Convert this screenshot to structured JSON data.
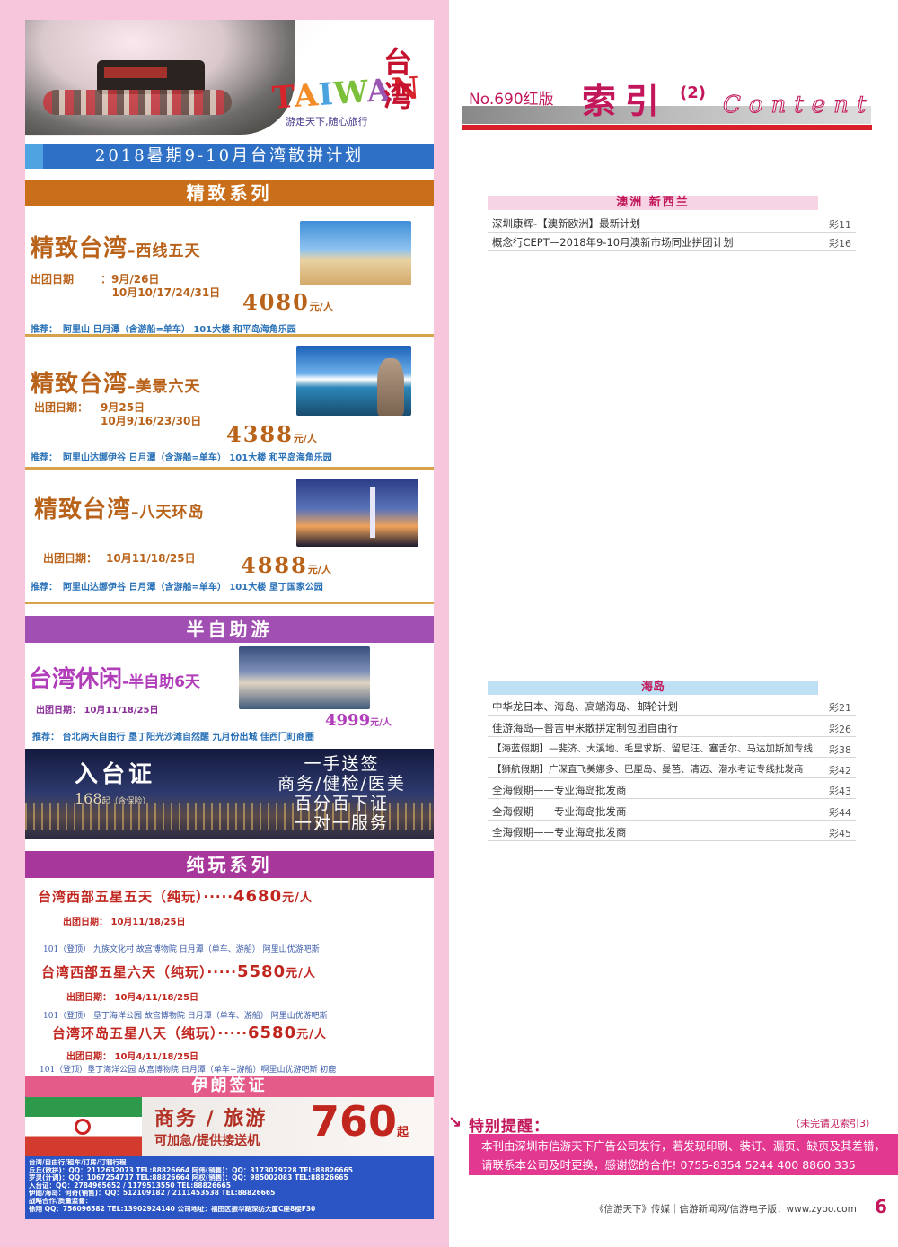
{
  "ad": {
    "logo_text": "TAIWAN",
    "logo_cn": "台湾",
    "logo_slogan": "游走天下,随心旅行",
    "plan_title": "2018暑期9-10月台湾散拼计划",
    "series_jingzhi": "精致系列",
    "tours": [
      {
        "title": "精致台湾",
        "subtitle": "–西线五天",
        "date_label": "出团日期",
        "dates": "：9月/26日\n   10月10/17/24/31日",
        "price": "4080",
        "unit": "元/人",
        "rec_label": "推荐：",
        "rec": "阿里山    日月潭（含游船=单车）     101大楼     和平岛海角乐园"
      },
      {
        "title": "精致台湾",
        "subtitle": "–美景六天",
        "date_label": "出团日期：",
        "dates": "9月25日\n10月9/16/23/30日",
        "price": "4388",
        "unit": "元/人",
        "rec_label": "推荐：",
        "rec": "阿里山达娜伊谷  日月潭（含游船=单车）   101大楼   和平岛海角乐园"
      },
      {
        "title": "精致台湾",
        "subtitle": "–八天环岛",
        "date_label": "出团日期：",
        "dates": "10月11/18/25日",
        "price": "4888",
        "unit": "元/人",
        "rec_label": "推荐：",
        "rec": "阿里山达娜伊谷  日月潭（含游船=单车）  101大楼   垦丁国家公园"
      }
    ],
    "series_semi": "半自助游",
    "leisure": {
      "title": "台湾休闲",
      "subtitle": "-半自助6天",
      "dates": "出团日期：  10月11/18/25日",
      "price": "4999",
      "unit": "元/人",
      "rec_label": "推荐：",
      "rec": "台北两天自由行   垦丁阳光沙滩自然醒    九月份出城    佳西门町商圈"
    },
    "permit": {
      "title": "入台证",
      "price": "168",
      "price_note": "起（含保险）",
      "lines": [
        "一手送签",
        "商务/健检/医美",
        "百分百下证",
        "一对一服务"
      ]
    },
    "series_pure": "纯玩系列",
    "pure": [
      {
        "title": "台湾西部五星五天（纯玩）·····",
        "price": "4680",
        "unit": "元/人",
        "date": "出团日期：  10月11/18/25日",
        "route": "101（登顶）   九族文化村   故宫博物院  日月潭（单车、游船）   阿里山优游吧斯"
      },
      {
        "title": "台湾西部五星六天（纯玩）·····",
        "price": "5580",
        "unit": "元/人",
        "date": "出团日期：  10月4/11/18/25日",
        "route": "101（登顶）   垦丁海洋公园  故宫博物院  日月潭（单车、游船）    阿里山优游吧斯"
      },
      {
        "title": "台湾环岛五星八天（纯玩）·····",
        "price": "6580",
        "unit": "元/人",
        "date": "出团日期：  10月4/11/18/25日",
        "route": "101（登顶）垦丁海洋公园 故宫博物院 日月潭（单车+游船）啊里山优游吧斯   初鹿"
      }
    ],
    "iran": {
      "bar": "伊朗签证",
      "line1": "商务 / 旅游",
      "line2": "可加急/提供接送机",
      "price": "760",
      "price_suffix": "起"
    },
    "contacts": [
      "台湾/自由行/租车/订房/订制行程",
      "丘丘(散拼)：QQ：2112632073  TEL:88826664          阿伟(销售)：QQ：3173079728   TEL:88826665",
      "罗灵(计调)：QQ：1067254717  TEL:88826664          阿权(销售)：QQ：985002083    TEL:88826665",
      "入台证：QQ：2784965652 / 1179513550  TEL:88826665",
      "伊朗/海岛：何奇(销售)：QQ：512109182 / 2111453538  TEL:88826665",
      "战略合作/质量监督：",
      "徐翔  QQ：756096582  TEL:13902924140      公司地址：福田区振华路深纺大厦C座8楼F30"
    ]
  },
  "index": {
    "issue": "No.690红版",
    "title": "索引",
    "sub": "(2)",
    "content_word": "Content",
    "categories": [
      {
        "name": "澳洲  新西兰",
        "rows": [
          {
            "text": "深圳康辉-【澳新欧洲】最新计划",
            "page": "彩11"
          },
          {
            "text": "概念行CEPT—2018年9-10月澳新市场同业拼团计划",
            "page": "彩16"
          }
        ]
      },
      {
        "name": "海岛",
        "rows": [
          {
            "text": "中华龙日本、海岛、高端海岛、邮轮计划",
            "page": "彩21"
          },
          {
            "text": "佳游海岛—普吉甲米散拼定制包团自由行",
            "page": "彩26"
          },
          {
            "text": "【海蓝假期】—斐济、大溪地、毛里求斯、留尼汪、塞舌尔、马达加斯加专线",
            "page": "彩38"
          },
          {
            "text": "【狮航假期】广深直飞美娜多、巴厘岛、曼芭、清迈、潜水考证专线批发商",
            "page": "彩42"
          },
          {
            "text": "全海假期——专业海岛批发商",
            "page": "彩43"
          },
          {
            "text": "全海假期——专业海岛批发商",
            "page": "彩44"
          },
          {
            "text": "全海假期——专业海岛批发商",
            "page": "彩45"
          }
        ]
      }
    ],
    "notice": {
      "arrow": "↘",
      "title": "特别提醒：",
      "more": "（未完请见索引3）",
      "line1": "本刊由深圳市信游天下广告公司发行，若发现印刷、装订、漏页、缺页及其差错，",
      "line2": "请联系本公司及时更换，感谢您的合作!   0755-8354 5244    400 8860 335"
    },
    "footer": "《信游天下》传媒｜信游新闻网/信游电子版：www.zyoo.com",
    "page_number": "6"
  }
}
